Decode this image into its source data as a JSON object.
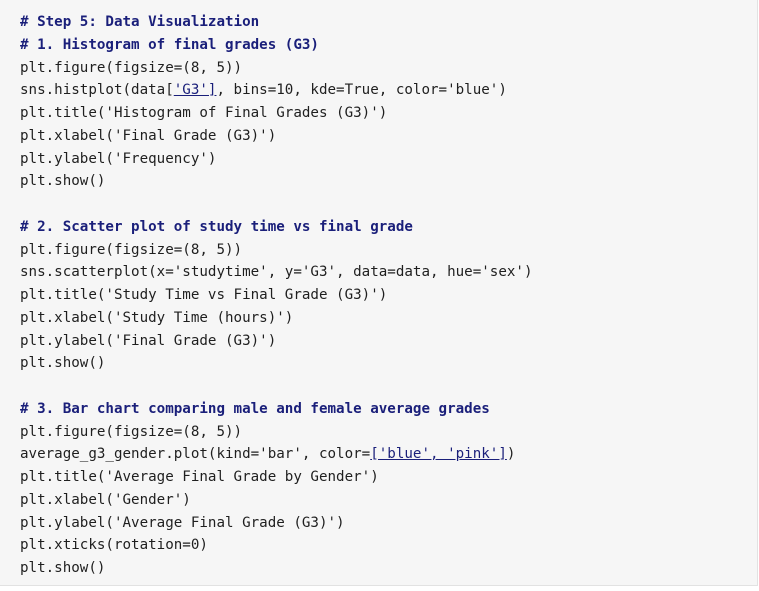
{
  "code": {
    "step_comment": "# Step 5: Data Visualization",
    "histogram": {
      "comment": "# 1. Histogram of final grades (G3)",
      "figure": "plt.figure(figsize=(8, 5))",
      "hist_pre": "sns.histplot(data[",
      "hist_link": "'G3']",
      "hist_post": ", bins=10, kde=True, color='blue')",
      "title": "plt.title('Histogram of Final Grades (G3)')",
      "xlabel": "plt.xlabel('Final Grade (G3)')",
      "ylabel": "plt.ylabel('Frequency')",
      "show": "plt.show()"
    },
    "scatter": {
      "comment": "# 2. Scatter plot of study time vs final grade",
      "figure": "plt.figure(figsize=(8, 5))",
      "scatter": "sns.scatterplot(x='studytime', y='G3', data=data, hue='sex')",
      "title": "plt.title('Study Time vs Final Grade (G3)')",
      "xlabel": "plt.xlabel('Study Time (hours)')",
      "ylabel": "plt.ylabel('Final Grade (G3)')",
      "show": "plt.show()"
    },
    "bar": {
      "comment": "# 3. Bar chart comparing male and female average grades",
      "figure": "plt.figure(figsize=(8, 5))",
      "plot_pre": "average_g3_gender.plot(kind='bar', color=",
      "plot_link": "['blue', 'pink']",
      "plot_post": ")",
      "title": "plt.title('Average Final Grade by Gender')",
      "xlabel": "plt.xlabel('Gender')",
      "ylabel": "plt.ylabel('Average Final Grade (G3)')",
      "xticks": "plt.xticks(rotation=0)",
      "show": "plt.show()"
    }
  }
}
